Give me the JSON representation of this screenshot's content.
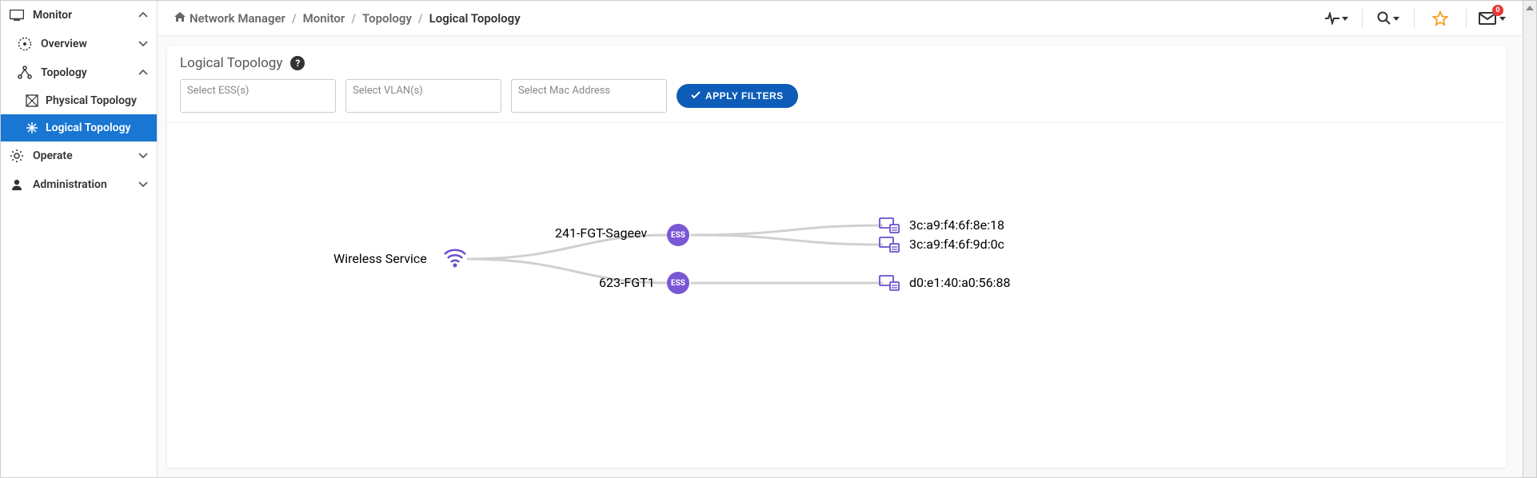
{
  "sidebar": {
    "items": [
      {
        "label": "Monitor",
        "expanded": true
      },
      {
        "label": "Overview",
        "level": 1
      },
      {
        "label": "Topology",
        "level": 1,
        "expanded": true
      },
      {
        "label": "Physical Topology",
        "level": 2
      },
      {
        "label": "Logical Topology",
        "level": 2,
        "active": true
      },
      {
        "label": "Operate"
      },
      {
        "label": "Administration"
      }
    ]
  },
  "breadcrumb": {
    "root": "Network Manager",
    "items": [
      "Monitor",
      "Topology",
      "Logical Topology"
    ]
  },
  "header": {
    "notifications_count": "0"
  },
  "panel": {
    "title": "Logical Topology",
    "filters": {
      "ess_placeholder": "Select ESS(s)",
      "vlan_placeholder": "Select VLAN(s)",
      "mac_placeholder": "Select Mac Address",
      "apply_label": "APPLY FILTERS"
    }
  },
  "topology": {
    "root_label": "Wireless Service",
    "ess_badge": "ESS",
    "ess_nodes": [
      {
        "label": "241-FGT-Sageev"
      },
      {
        "label": "623-FGT1"
      }
    ],
    "devices": [
      {
        "mac": "3c:a9:f4:6f:8e:18"
      },
      {
        "mac": "3c:a9:f4:6f:9d:0c"
      },
      {
        "mac": "d0:e1:40:a0:56:88"
      }
    ]
  }
}
